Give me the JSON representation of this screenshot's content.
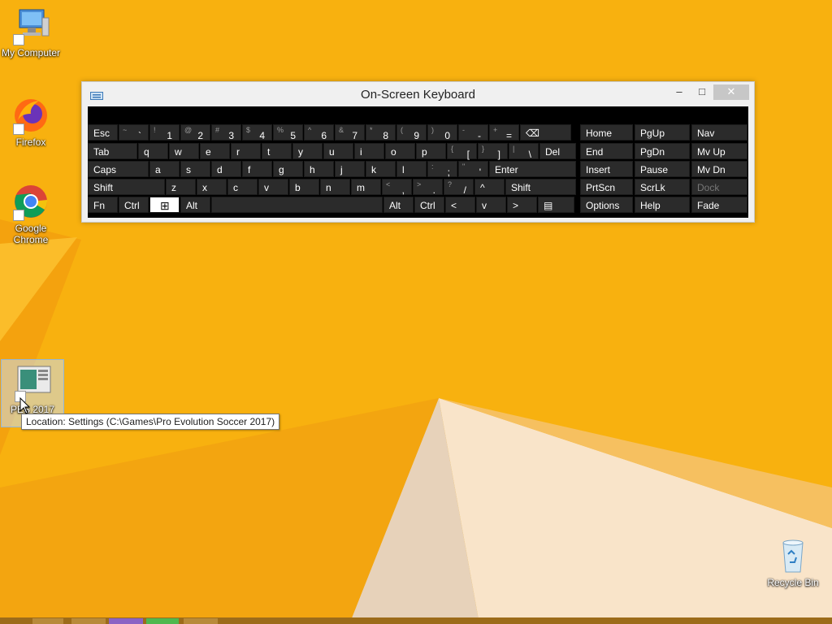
{
  "desktop": {
    "icons": [
      {
        "label": "My Computer"
      },
      {
        "label": "Firefox"
      },
      {
        "label": "Google Chrome"
      },
      {
        "label": "PES 2017"
      },
      {
        "label": "Recycle Bin"
      }
    ],
    "selected_icon_label_line1": "PES 2017",
    "selected_icon_label_line2": "S"
  },
  "tooltip": {
    "text": "Location: Settings (C:\\Games\\Pro Evolution Soccer 2017)"
  },
  "osk": {
    "title": "On-Screen Keyboard",
    "window_controls": {
      "minimize": "–",
      "maximize": "□",
      "close": "✕"
    },
    "rows": [
      [
        {
          "label": "Esc"
        },
        {
          "sec": "~",
          "pri": "`"
        },
        {
          "sec": "!",
          "pri": "1"
        },
        {
          "sec": "@",
          "pri": "2"
        },
        {
          "sec": "#",
          "pri": "3"
        },
        {
          "sec": "$",
          "pri": "4"
        },
        {
          "sec": "%",
          "pri": "5"
        },
        {
          "sec": "^",
          "pri": "6"
        },
        {
          "sec": "&",
          "pri": "7"
        },
        {
          "sec": "*",
          "pri": "8"
        },
        {
          "sec": "(",
          "pri": "9"
        },
        {
          "sec": ")",
          "pri": "0"
        },
        {
          "sec": "-",
          "pri": "-"
        },
        {
          "sec": "+",
          "pri": "="
        },
        {
          "label": "⌫"
        }
      ],
      [
        {
          "label": "Tab"
        },
        {
          "label": "q"
        },
        {
          "label": "w"
        },
        {
          "label": "e"
        },
        {
          "label": "r"
        },
        {
          "label": "t"
        },
        {
          "label": "y"
        },
        {
          "label": "u"
        },
        {
          "label": "i"
        },
        {
          "label": "o"
        },
        {
          "label": "p"
        },
        {
          "sec": "{",
          "pri": "["
        },
        {
          "sec": "}",
          "pri": "]"
        },
        {
          "sec": "|",
          "pri": "\\"
        },
        {
          "label": "Del"
        }
      ],
      [
        {
          "label": "Caps"
        },
        {
          "label": "a"
        },
        {
          "label": "s"
        },
        {
          "label": "d"
        },
        {
          "label": "f"
        },
        {
          "label": "g"
        },
        {
          "label": "h"
        },
        {
          "label": "j"
        },
        {
          "label": "k"
        },
        {
          "label": "l"
        },
        {
          "sec": ":",
          "pri": ";"
        },
        {
          "sec": "\"",
          "pri": "'"
        },
        {
          "label": "Enter"
        }
      ],
      [
        {
          "label": "Shift"
        },
        {
          "label": "z"
        },
        {
          "label": "x"
        },
        {
          "label": "c"
        },
        {
          "label": "v"
        },
        {
          "label": "b"
        },
        {
          "label": "n"
        },
        {
          "label": "m"
        },
        {
          "sec": "<",
          "pri": ","
        },
        {
          "sec": ">",
          "pri": "."
        },
        {
          "sec": "?",
          "pri": "/"
        },
        {
          "label": "^"
        },
        {
          "label": "Shift"
        }
      ],
      [
        {
          "label": "Fn"
        },
        {
          "label": "Ctrl"
        },
        {
          "label": "⊞"
        },
        {
          "label": "Alt"
        },
        {
          "label": ""
        },
        {
          "label": "Alt"
        },
        {
          "label": "Ctrl"
        },
        {
          "label": "<"
        },
        {
          "label": "v"
        },
        {
          "label": ">"
        },
        {
          "label": "▤"
        }
      ]
    ],
    "nav_keys": [
      [
        "Home",
        "PgUp",
        "Nav"
      ],
      [
        "End",
        "PgDn",
        "Mv Up"
      ],
      [
        "Insert",
        "Pause",
        "Mv Dn"
      ],
      [
        "PrtScn",
        "ScrLk",
        "Dock"
      ],
      [
        "Options",
        "Help",
        "Fade"
      ]
    ]
  },
  "colors": {
    "wallpaper": "#f7b313",
    "key": "#2b2b2b",
    "key_text": "#ffffff"
  }
}
